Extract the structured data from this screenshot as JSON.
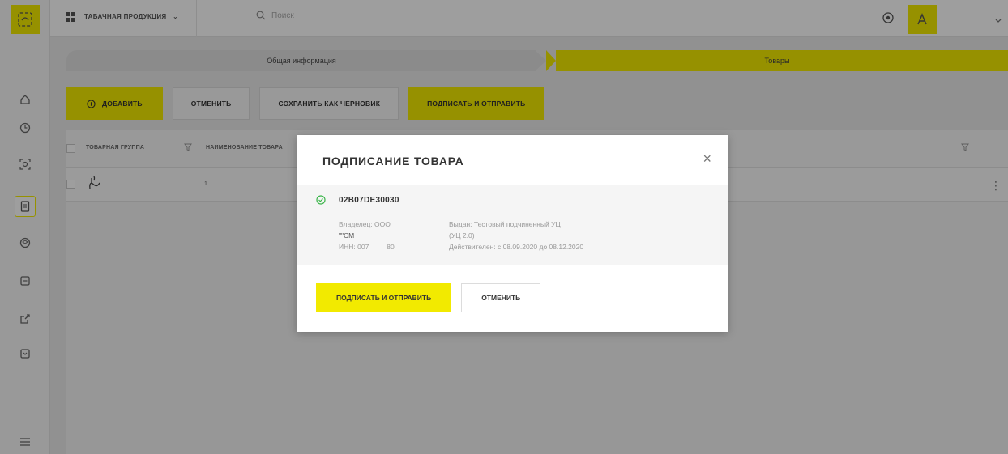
{
  "colors": {
    "accent": "#f2ea00"
  },
  "topbar": {
    "product_group": "ТАБАЧНАЯ ПРОДУКЦИЯ",
    "search_placeholder": "Поиск"
  },
  "rail": {
    "icons": [
      "logo-icon",
      "home-icon",
      "clock-icon",
      "scan-icon",
      "document-icon",
      "box-icon",
      "receipt-icon",
      "export-icon",
      "archive-icon",
      "menu-icon"
    ]
  },
  "steps": {
    "step1": "Общая информация",
    "step2": "Товары"
  },
  "toolbar": {
    "add": "ДОБАВИТЬ",
    "cancel": "ОТМЕНИТЬ",
    "save_draft": "СОХРАНИТЬ КАК ЧЕРНОВИК",
    "sign_send": "ПОДПИСАТЬ И ОТПРАВИТЬ"
  },
  "table": {
    "headers": {
      "group": "ТОВАРНАЯ ГРУППА",
      "name": "НАИМЕНОВАНИЕ ТОВАРА"
    },
    "rows": [
      {
        "index": "1"
      }
    ]
  },
  "modal": {
    "title": "ПОДПИСАНИЕ ТОВАРА",
    "cert_id": "02B07DE30030",
    "owner_label": "Владелец: ООО",
    "owner_line2": "\"\"СМ",
    "inn_label": "ИНН: 007",
    "inn_tail": "80",
    "issuer": "Выдан: Тестовый подчиненный УЦ",
    "issuer_line2": "(УЦ 2.0)",
    "valid": "Действителен: с 08.09.2020 до 08.12.2020",
    "sign_button": "ПОДПИСАТЬ И ОТПРАВИТЬ",
    "cancel_button": "ОТМЕНИТЬ"
  }
}
